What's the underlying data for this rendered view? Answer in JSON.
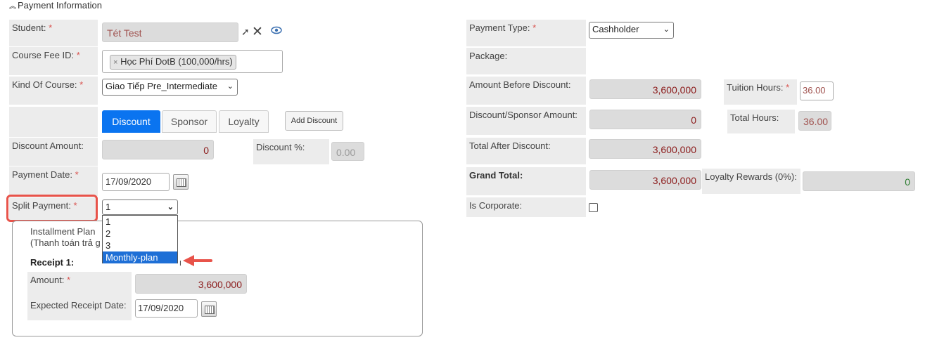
{
  "section_title": "Payment Information",
  "student": {
    "label": "Student:",
    "required": "*",
    "value": "Tét Test"
  },
  "course_fee": {
    "label": "Course Fee ID:",
    "required": "*",
    "tag_remove": "×",
    "tag": "Học Phí DotB (100,000/hrs)"
  },
  "kind_of_course": {
    "label": "Kind Of Course:",
    "required": "*",
    "value": "Giao Tiếp Pre_Intermediate"
  },
  "tabs": {
    "discount": "Discount",
    "sponsor": "Sponsor",
    "loyalty": "Loyalty",
    "add_discount": "Add Discount"
  },
  "discount_amount": {
    "label": "Discount Amount:",
    "value": "0"
  },
  "discount_pct": {
    "label": "Discount %:",
    "value": "0.00"
  },
  "payment_date": {
    "label": "Payment Date:",
    "required": "*",
    "value": "17/09/2020"
  },
  "split_payment": {
    "label": "Split Payment:",
    "required": "*",
    "value": "1",
    "options": [
      "1",
      "2",
      "3",
      "Monthly-plan"
    ],
    "highlighted": "Monthly-plan"
  },
  "installment": {
    "line1": "Installment Plan",
    "line2": "(Thanh toán trả g"
  },
  "receipt": {
    "title": "Receipt 1:",
    "amount_label": "Amount:",
    "required": "*",
    "amount_value": "3,600,000",
    "date_label": "Expected Receipt Date:",
    "date_value": "17/09/2020"
  },
  "payment_type": {
    "label": "Payment Type:",
    "required": "*",
    "value": "Cashholder"
  },
  "package": {
    "label": "Package:"
  },
  "amount_before_discount": {
    "label": "Amount Before Discount:",
    "value": "3,600,000"
  },
  "tuition_hours": {
    "label": "Tuition Hours:",
    "required": "*",
    "value": "36.00"
  },
  "discount_sponsor_amount": {
    "label": "Discount/Sponsor Amount:",
    "value": "0"
  },
  "total_hours": {
    "label": "Total Hours:",
    "value": "36.00"
  },
  "total_after_discount": {
    "label": "Total After Discount:",
    "value": "3,600,000"
  },
  "grand_total": {
    "label": "Grand Total:",
    "value": "3,600,000"
  },
  "loyalty_rewards": {
    "label": "Loyalty Rewards (0%):",
    "value": "0"
  },
  "is_corporate": {
    "label": "Is Corporate:"
  },
  "colors": {
    "accent": "#0a74f0",
    "highlight": "#e8534a",
    "value_red": "#8b1a1a"
  }
}
